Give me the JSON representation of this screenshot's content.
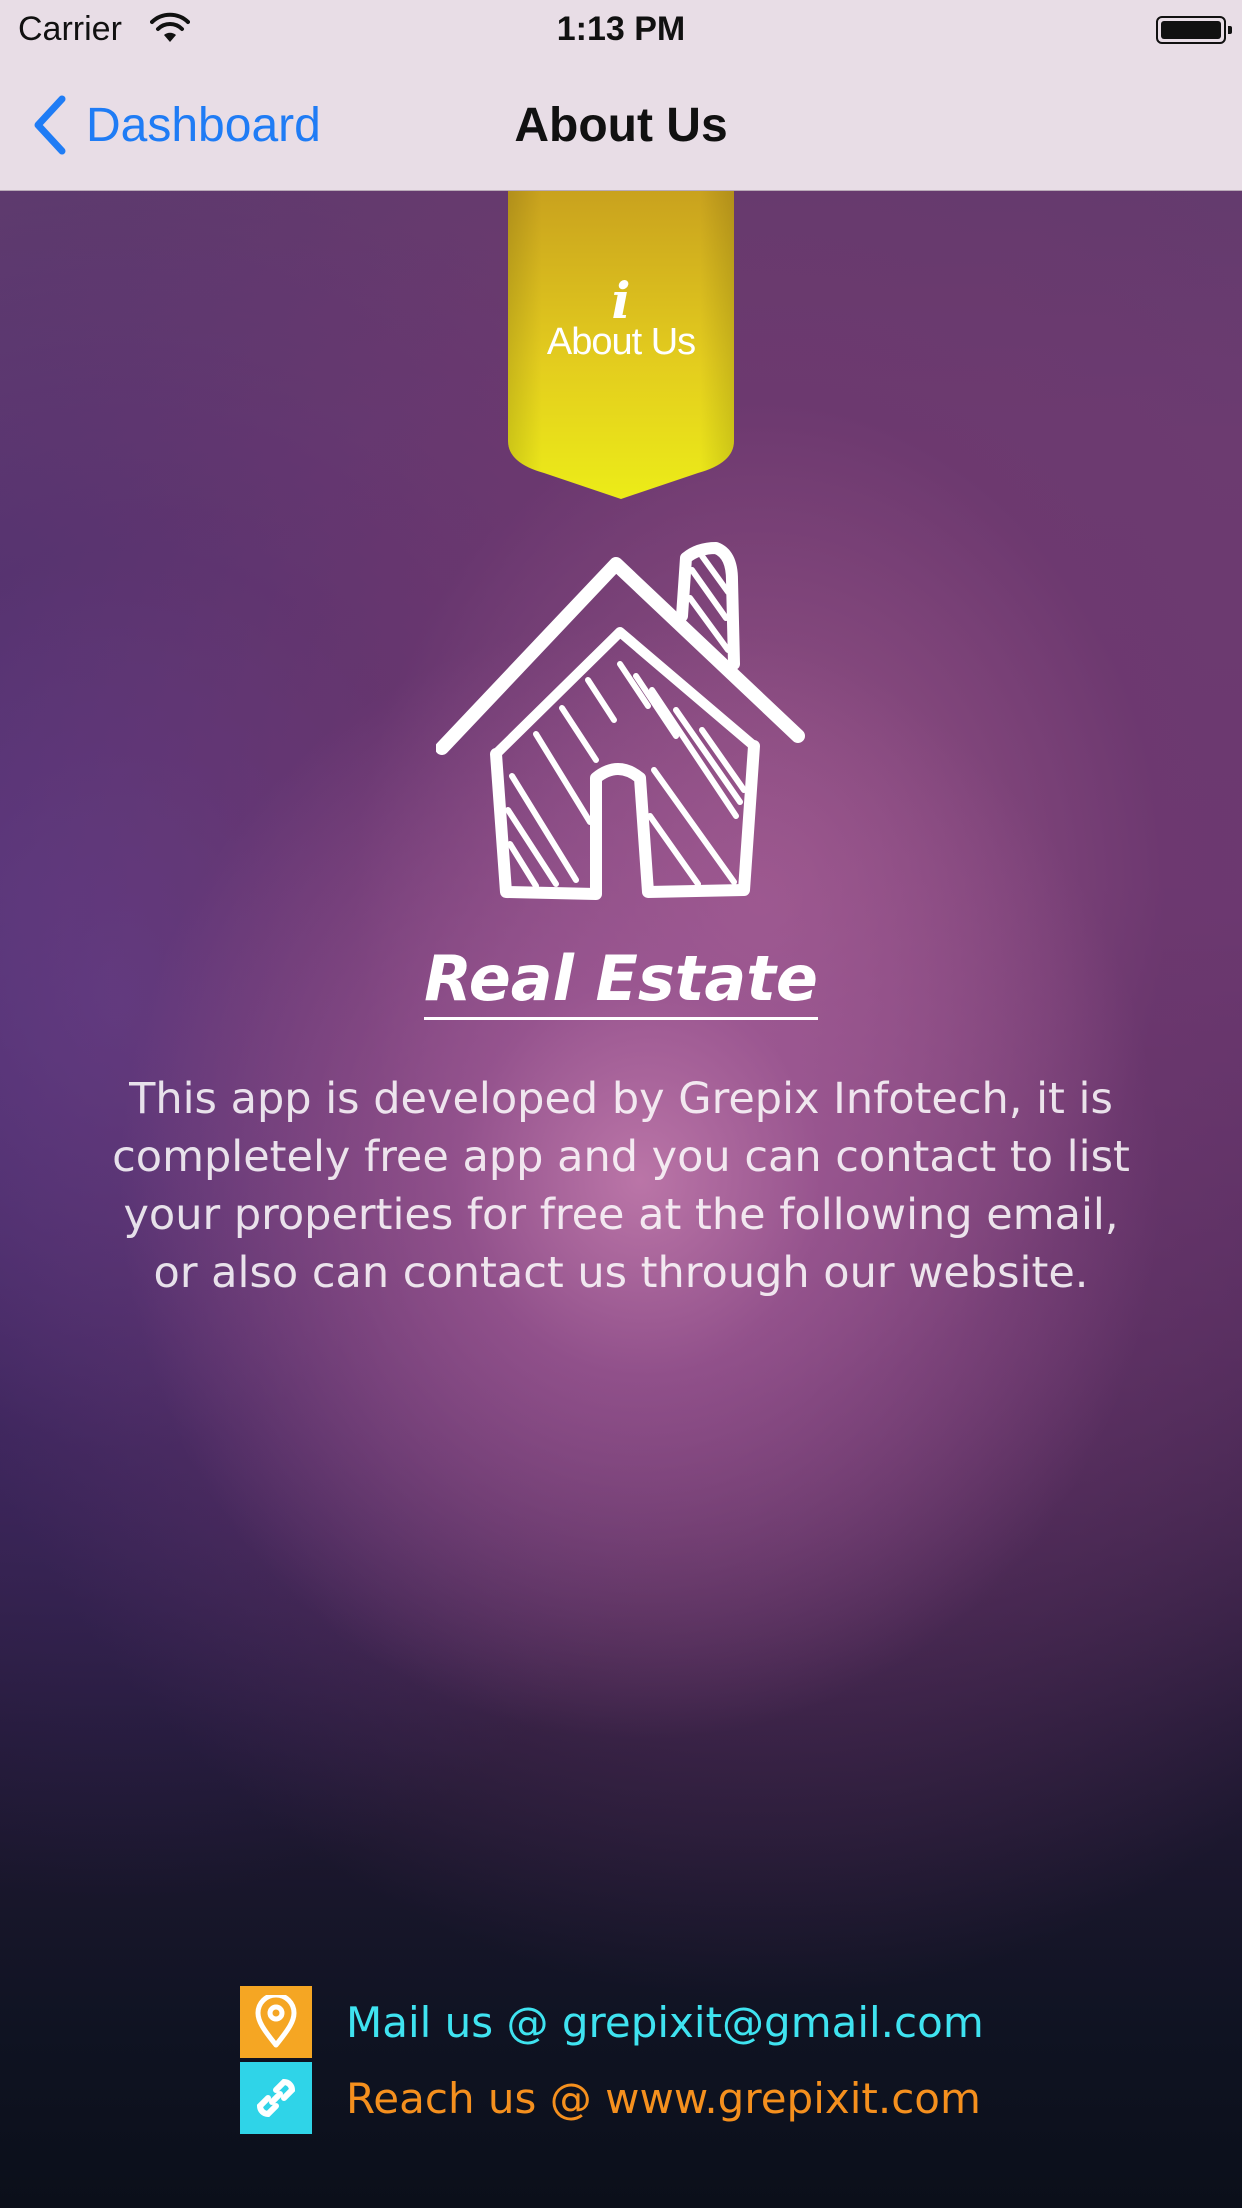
{
  "status_bar": {
    "carrier": "Carrier",
    "time": "1:13 PM"
  },
  "nav": {
    "back_label": "Dashboard",
    "title": "About Us"
  },
  "ribbon": {
    "icon": "i",
    "label": "About Us",
    "color_top": "#d8b520",
    "color_bottom": "#e8e81a"
  },
  "brand": {
    "title": "Real Estate",
    "icon": "house-icon"
  },
  "description": "This app is developed by Grepix Infotech, it is completely free app and you can contact to list your properties for free at the following email, or also can contact us through our website.",
  "contacts": {
    "mail": {
      "label": "Mail us @ grepixit@gmail.com",
      "icon": "location-pin-icon",
      "icon_bg": "#f5a623",
      "text_color": "#3fe3f0"
    },
    "web": {
      "label": "Reach us @ www.grepixit.com",
      "icon": "link-icon",
      "icon_bg": "#2fd4e8",
      "text_color": "#f5901e"
    }
  },
  "colors": {
    "accent_blue": "#1f7cf5",
    "bar_bg": "#e8dde6"
  }
}
